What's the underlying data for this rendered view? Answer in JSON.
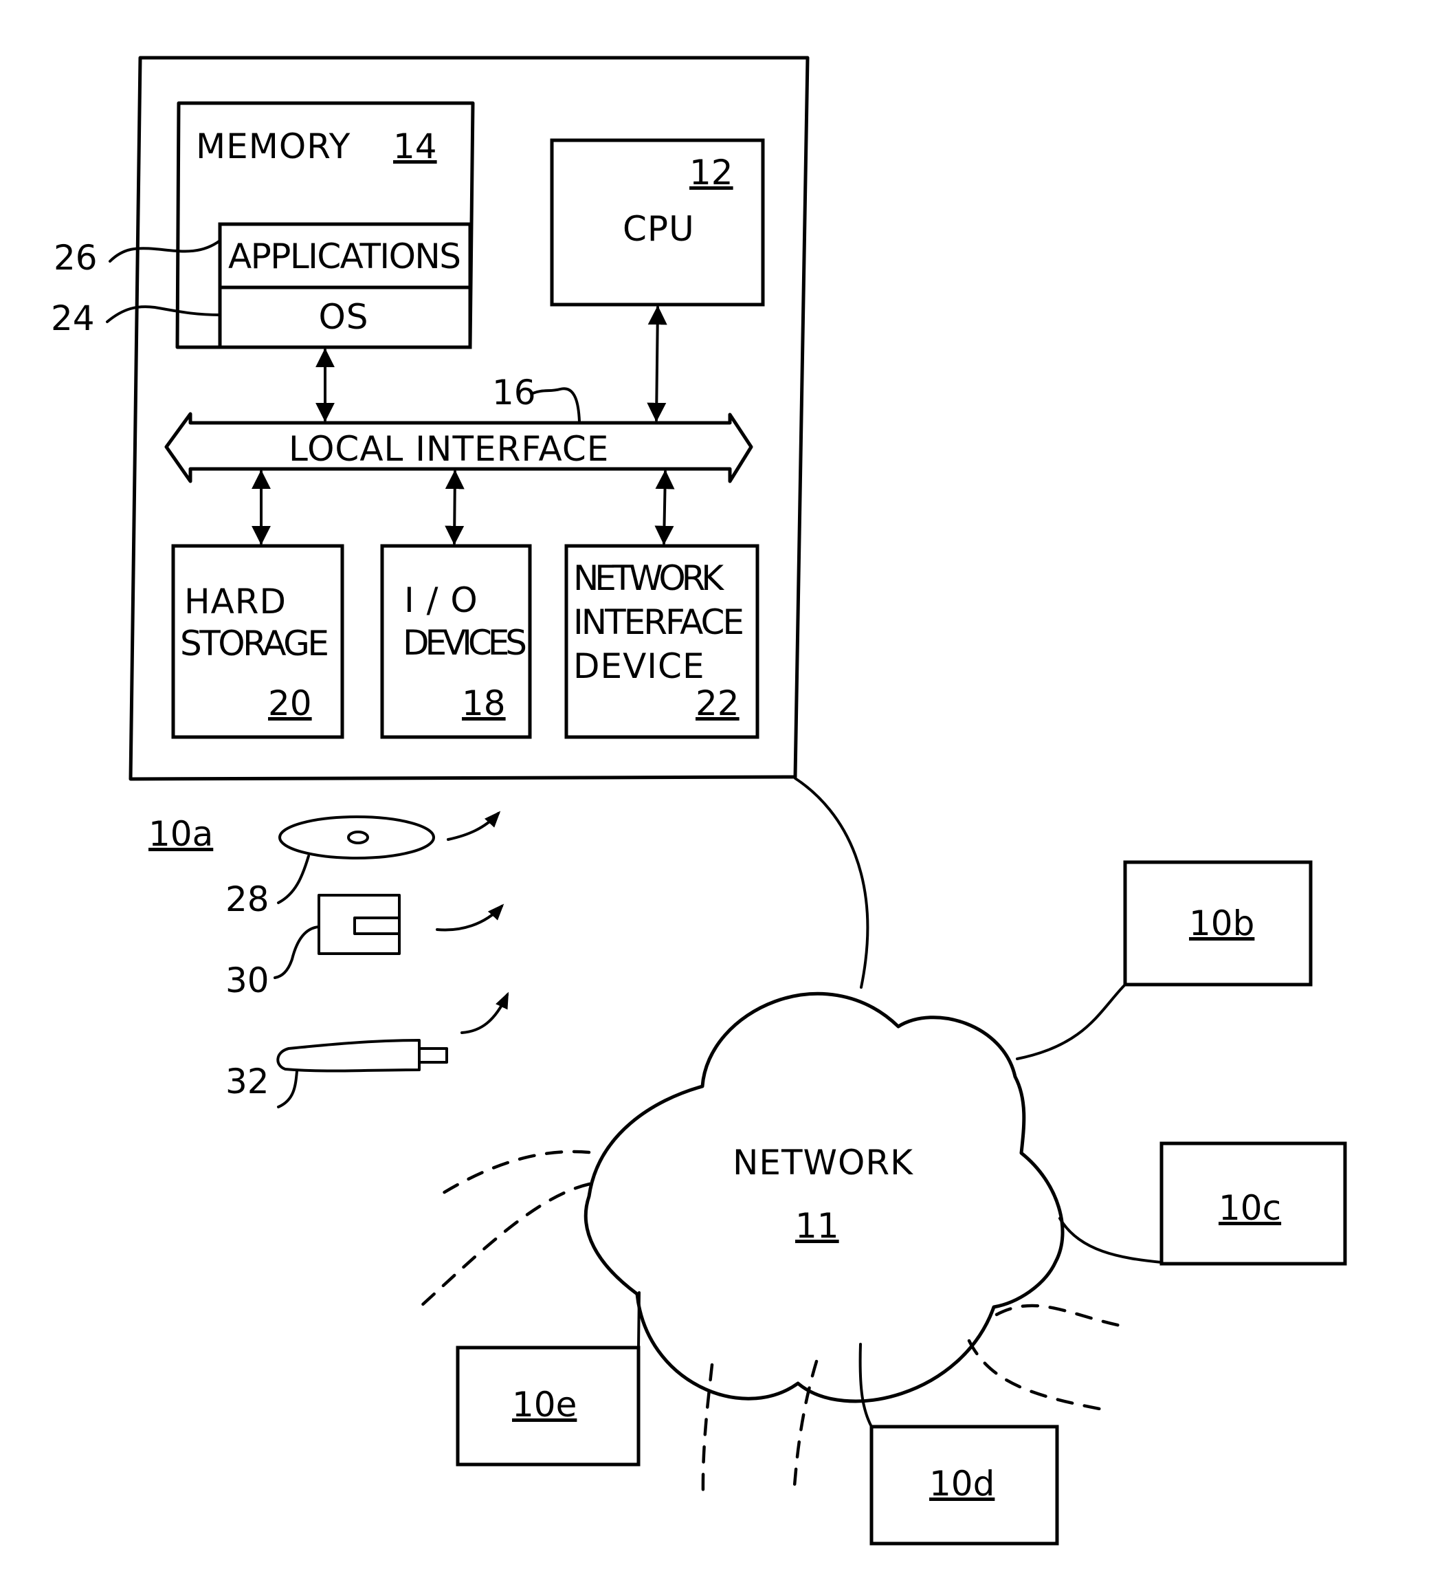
{
  "computer": {
    "ref": "10a",
    "memory": {
      "label": "MEMORY",
      "ref": "14"
    },
    "applications": {
      "label": "APPLICATIONS",
      "ref": "26"
    },
    "os": {
      "label": "OS",
      "ref": "24"
    },
    "cpu": {
      "label": "CPU",
      "ref": "12"
    },
    "local_interface": {
      "label": "LOCAL INTERFACE",
      "ref": "16"
    },
    "hard_storage": {
      "label_lines": [
        "HARD",
        "STORAGE"
      ],
      "ref": "20"
    },
    "io_devices": {
      "label_lines": [
        "I / O",
        "DEVICES"
      ],
      "ref": "18"
    },
    "network_interface_device": {
      "label_lines": [
        "NETWORK",
        "INTERFACE",
        "DEVICE"
      ],
      "ref": "22"
    }
  },
  "media": [
    {
      "name": "optical-disc",
      "ref": "28"
    },
    {
      "name": "memory-card",
      "ref": "30"
    },
    {
      "name": "usb-drive",
      "ref": "32"
    }
  ],
  "network": {
    "label": "NETWORK",
    "ref": "11"
  },
  "remote_computers": [
    {
      "ref": "10b"
    },
    {
      "ref": "10c"
    },
    {
      "ref": "10d"
    },
    {
      "ref": "10e"
    }
  ]
}
